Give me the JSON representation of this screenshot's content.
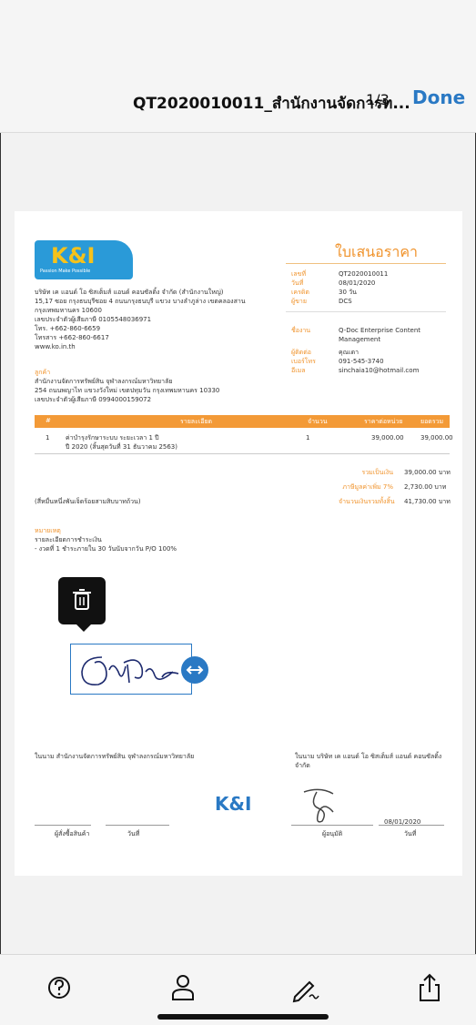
{
  "nav": {
    "title": "QT2020010011_สำนักงานจัดการท...",
    "pages": "1/3",
    "done": "Done"
  },
  "doc": {
    "logo_text": "K&I",
    "logo_sub": "Passion Make Possible",
    "title": "ใบเสนอราคา",
    "company": [
      "บริษัท เค แอนด์ โอ ซิสเต็มส์ แอนด์ คอนซัลติ้ง จำกัด (สำนักงานใหญ่)",
      "15,17 ซอย กรุงธนบุรีซอย 4 ถนนกรุงธนบุรี แขวง บางลำภูล่าง เขตคลองสาน",
      "กรุงเทพมหานคร 10600",
      "เลขประจำตัวผู้เสียภาษี 0105548036971",
      "โทร. +662-860-6659",
      "โทรสาร +662-860-6617",
      "www.ko.in.th"
    ],
    "info_labels": [
      "เลขที่",
      "วันที่",
      "เครดิต",
      "ผู้ขาย"
    ],
    "info_values": [
      "QT2020010011",
      "08/01/2020",
      "30 วัน",
      "DCS"
    ],
    "project_label": "ชื่องาน",
    "project_value": [
      "Q-Doc Enterprise Content",
      "Management"
    ],
    "contact_labels": [
      "ผู้ติดต่อ",
      "เบอร์โทร",
      "อีเมล"
    ],
    "contact_values": [
      "คุณเดา",
      "091-545-3740",
      "sinchaia10@hotmail.com"
    ],
    "customer_label": "ลูกค้า",
    "customer": [
      "สำนักงานจัดการทรัพย์สิน จุฬาลงกรณ์มหาวิทยาลัย",
      "254 ถนนพญาไท แขวงวังใหม่ เขตปทุมวัน กรุงเทพมหานคร 10330",
      "เลขประจำตัวผู้เสียภาษี 0994000159072"
    ],
    "table_headers": [
      "#",
      "รายละเอียด",
      "จำนวน",
      "ราคาต่อหน่วย",
      "ยอดรวม"
    ],
    "row": {
      "no": "1",
      "desc1": "ค่าบำรุงรักษาระบบ ระยะเวลา 1 ปี",
      "desc2": "ปี 2020 (สิ้นสุดวันที่ 31 ธันวาคม 2563)",
      "qty": "1",
      "unit": "39,000.00",
      "total": "39,000.00"
    },
    "totals_labels": [
      "รวมเป็นเงิน",
      "ภาษีมูลค่าเพิ่ม 7%",
      "จำนวนเงินรวมทั้งสิ้น"
    ],
    "totals_values": [
      "39,000.00 บาท",
      "2,730.00 บาท",
      "41,730.00 บาท"
    ],
    "amount_words": "(สี่หมื่นหนึ่งพันเจ็ดร้อยสามสิบบาทถ้วน)",
    "remarks_label": "หมายเหตุ",
    "remarks": [
      "รายละเอียดการชำระเงิน",
      "- งวดที่ 1 ชำระภายใน 30 วันนับจากวัน P/O 100%"
    ],
    "sign_left_title": "ในนาม สำนักงานจัดการทรัพย์สิน จุฬาลงกรณ์มหาวิทยาลัย",
    "sign_right_title": [
      "ในนาม บริษัท เค แอนด์ โอ ซิสเต็มส์ แอนด์ คอนซัลติ้ง",
      "จำกัด"
    ],
    "sign_left_labels": [
      "ผู้สั่งซื้อสินค้า",
      "วันที่"
    ],
    "sign_right_labels": [
      "ผู้อนุมัติ",
      "วันที่"
    ],
    "sign_date": "08/01/2020"
  },
  "colors": {
    "accent": "#2a79c4",
    "orange": "#f0932c"
  },
  "toolbar_icons": [
    "help-icon",
    "person-icon",
    "signature-icon",
    "share-icon"
  ]
}
